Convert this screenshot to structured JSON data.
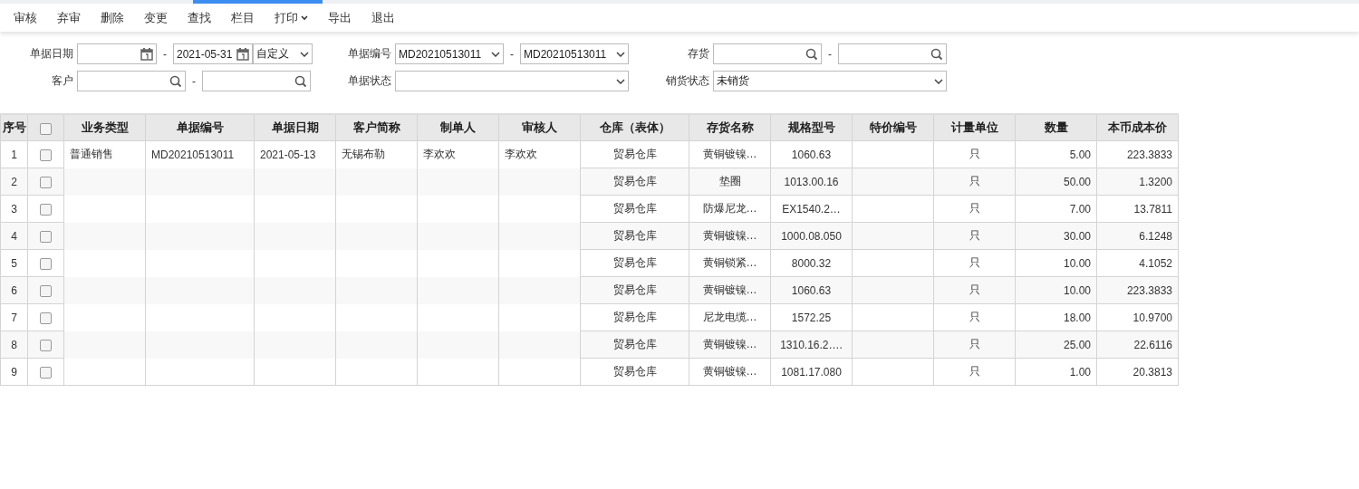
{
  "toolbar": [
    {
      "label": "审核",
      "kind": "button"
    },
    {
      "label": "弃审",
      "kind": "button"
    },
    {
      "label": "删除",
      "kind": "button"
    },
    {
      "label": "变更",
      "kind": "button"
    },
    {
      "label": "查找",
      "kind": "button"
    },
    {
      "label": "栏目",
      "kind": "button"
    },
    {
      "label": "打印",
      "kind": "dropdown"
    },
    {
      "label": "导出",
      "kind": "button"
    },
    {
      "label": "退出",
      "kind": "button"
    }
  ],
  "filters": [
    [
      {
        "label": "单据日期",
        "kind": "date_range",
        "to_value": "2021-05-31",
        "preset": "自定义",
        "separator": "-"
      },
      {
        "label": "单据编号",
        "kind": "select_range",
        "from_value": "MD20210513011",
        "to_value": "MD20210513011",
        "separator": "-"
      },
      {
        "label": "存货",
        "kind": "search_range",
        "separator": "-"
      }
    ],
    [
      {
        "label": "客户",
        "kind": "search_range",
        "separator": "-"
      },
      {
        "label": "单据状态",
        "kind": "select"
      },
      {
        "label": "销货状态",
        "kind": "select",
        "value": "未销货"
      }
    ]
  ],
  "table": {
    "all_checked": false,
    "columns": [
      "序号",
      "业务类型",
      "单据编号",
      "单据日期",
      "客户简称",
      "制单人",
      "审核人",
      "仓库（表体）",
      "存货名称",
      "规格型号",
      "特价编号",
      "计量单位",
      "数量",
      "本币成本价"
    ],
    "rows": [
      {
        "seq": "1",
        "checked": false,
        "business_type": "普通销售",
        "doc_no": "MD20210513011",
        "doc_date": "2021-05-13",
        "customer": "无锡布勒",
        "creator": "李欢欢",
        "auditor": "李欢欢",
        "warehouse": "贸易仓库",
        "item_name": "黄铜镀镍…",
        "spec": "1060.63",
        "unit": "只",
        "qty": "5.00",
        "cost": "223.3833"
      },
      {
        "seq": "2",
        "checked": false,
        "warehouse": "贸易仓库",
        "item_name": "垫圈",
        "spec": "1013.00.16",
        "unit": "只",
        "qty": "50.00",
        "cost": "1.3200"
      },
      {
        "seq": "3",
        "checked": false,
        "warehouse": "贸易仓库",
        "item_name": "防爆尼龙…",
        "spec": "EX1540.2…",
        "unit": "只",
        "qty": "7.00",
        "cost": "13.7811"
      },
      {
        "seq": "4",
        "checked": false,
        "warehouse": "贸易仓库",
        "item_name": "黄铜镀镍…",
        "spec": "1000.08.050",
        "unit": "只",
        "qty": "30.00",
        "cost": "6.1248"
      },
      {
        "seq": "5",
        "checked": false,
        "warehouse": "贸易仓库",
        "item_name": "黄铜锁紧…",
        "spec": "8000.32",
        "unit": "只",
        "qty": "10.00",
        "cost": "4.1052"
      },
      {
        "seq": "6",
        "checked": false,
        "warehouse": "贸易仓库",
        "item_name": "黄铜镀镍…",
        "spec": "1060.63",
        "unit": "只",
        "qty": "10.00",
        "cost": "223.3833"
      },
      {
        "seq": "7",
        "checked": false,
        "warehouse": "贸易仓库",
        "item_name": "尼龙电缆…",
        "spec": "1572.25",
        "unit": "只",
        "qty": "18.00",
        "cost": "10.9700"
      },
      {
        "seq": "8",
        "checked": false,
        "warehouse": "贸易仓库",
        "item_name": "黄铜镀镍…",
        "spec": "1310.16.2….",
        "unit": "只",
        "qty": "25.00",
        "cost": "22.6116"
      },
      {
        "seq": "9",
        "checked": false,
        "warehouse": "贸易仓库",
        "item_name": "黄铜镀镍…",
        "spec": "1081.17.080",
        "unit": "只",
        "qty": "1.00",
        "cost": "20.3813"
      }
    ]
  }
}
